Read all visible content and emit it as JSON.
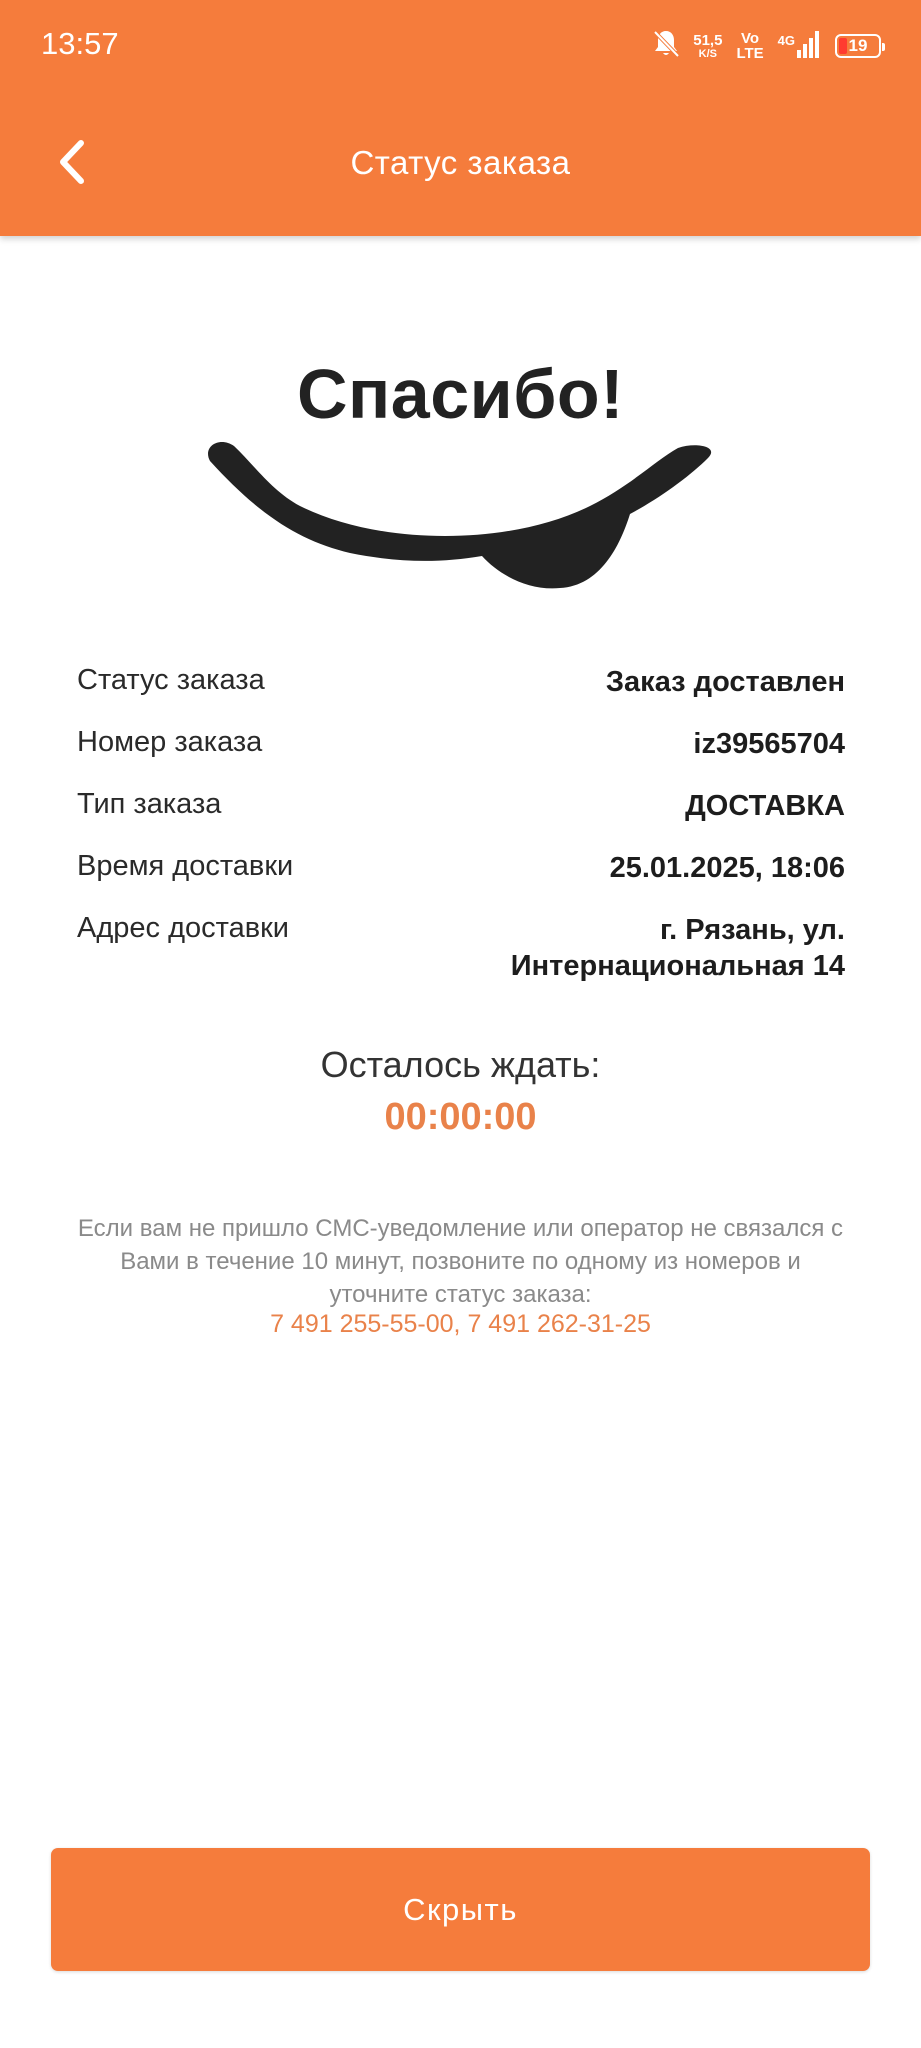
{
  "status_bar": {
    "time": "13:57",
    "net_speed_value": "51,5",
    "net_speed_unit": "K/S",
    "volte_top": "Vo",
    "volte_bottom": "LTE",
    "network_type": "4G",
    "battery_level": "19",
    "icons": [
      "bell-muted-icon",
      "signal-bars-icon",
      "battery-icon"
    ]
  },
  "header": {
    "title": "Статус заказа",
    "back_icon": "chevron-left-icon",
    "background_color": "#f57c3c"
  },
  "hero": {
    "title": "Спасибо!"
  },
  "order_info": [
    {
      "label": "Статус заказа",
      "value": "Заказ доставлен"
    },
    {
      "label": "Номер заказа",
      "value": "iz39565704"
    },
    {
      "label": "Тип заказа",
      "value": "ДОСТАВКА"
    },
    {
      "label": "Время доставки",
      "value": "25.01.2025, 18:06"
    },
    {
      "label": "Адрес доставки",
      "value": "г. Рязань, ул. Интернациональная 14"
    }
  ],
  "wait": {
    "label": "Осталось ждать:",
    "timer": "00:00:00",
    "timer_color": "#e9824a"
  },
  "notice": {
    "text": "Если вам не пришло СМС-уведомление или оператор не связался с Вами в течение 10 минут, позвоните по одному из номеров и уточните статус заказа:",
    "phone_1": "7 491 255-55-00",
    "separator": ", ",
    "phone_2": "7 491 262-31-25"
  },
  "footer": {
    "hide_button_label": "Скрыть"
  }
}
